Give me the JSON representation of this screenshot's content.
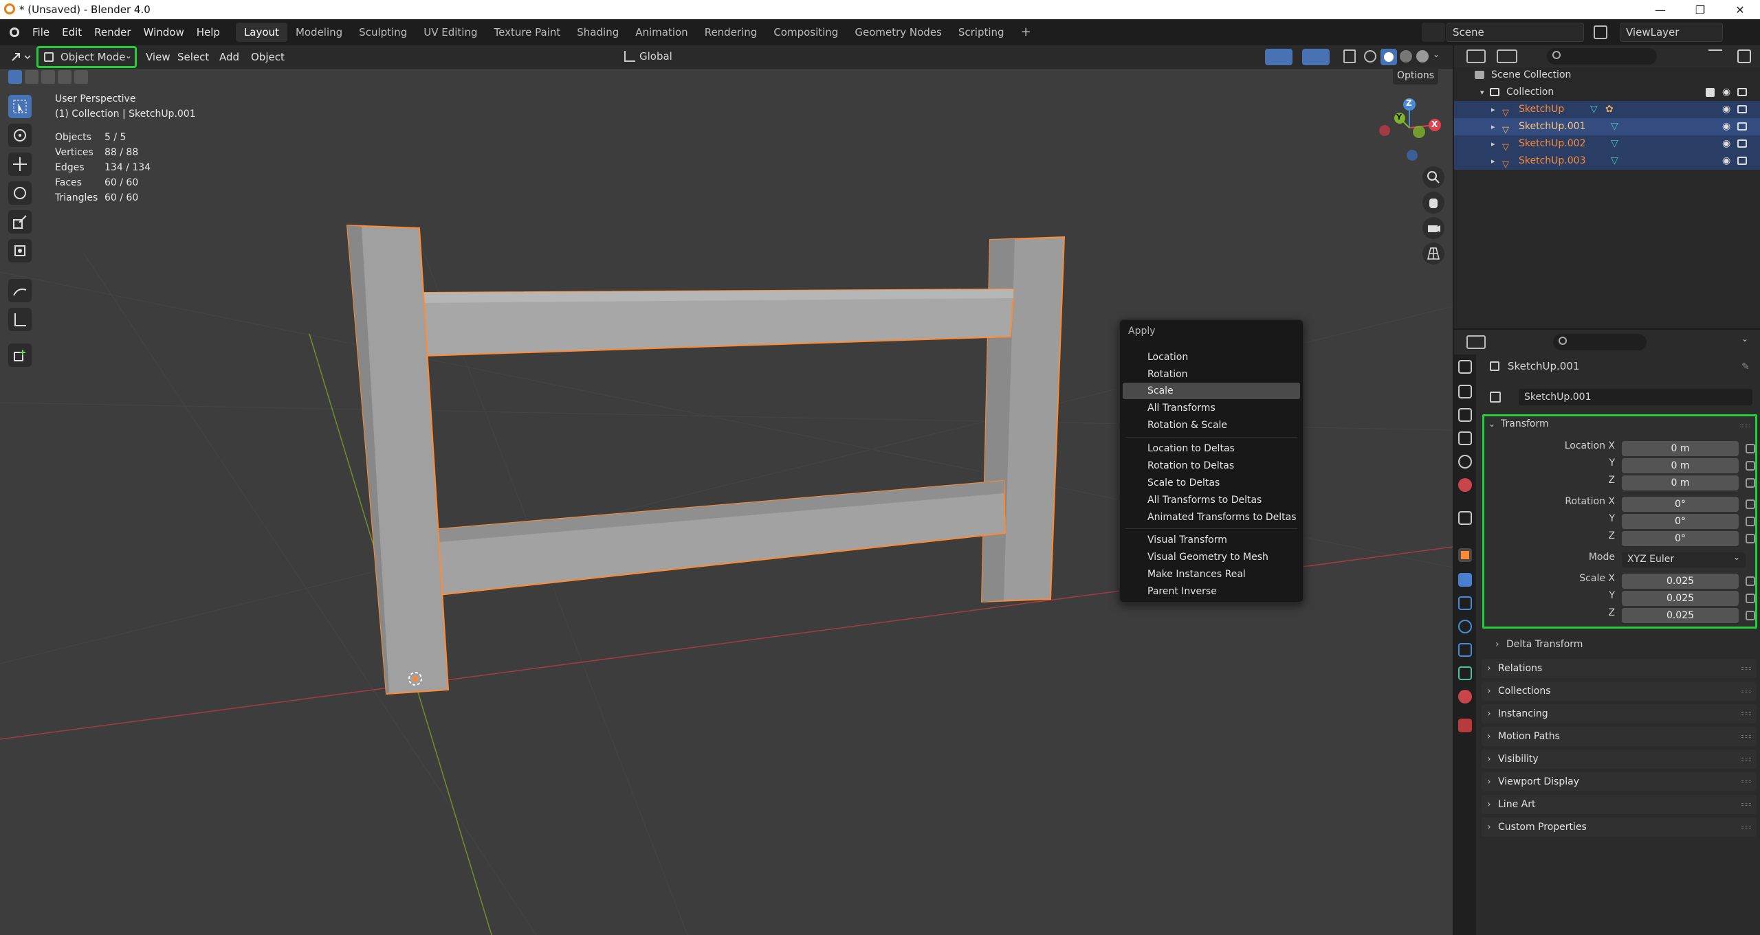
{
  "window": {
    "title": "* (Unsaved) - Blender 4.0",
    "min": "—",
    "max": "❐",
    "close": "✕"
  },
  "menu": [
    "File",
    "Edit",
    "Render",
    "Window",
    "Help"
  ],
  "workspaces": [
    "Layout",
    "Modeling",
    "Sculpting",
    "UV Editing",
    "Texture Paint",
    "Shading",
    "Animation",
    "Rendering",
    "Compositing",
    "Geometry Nodes",
    "Scripting"
  ],
  "add_workspace": "+",
  "scene": {
    "name": "Scene",
    "view_layer": "ViewLayer"
  },
  "viewport": {
    "mode": "Object Mode",
    "header_menus": [
      "View",
      "Select",
      "Add",
      "Object"
    ],
    "orientation": "Global",
    "options": "Options",
    "overlay_title": "User Perspective",
    "overlay_sub": "(1) Collection | SketchUp.001",
    "stats": [
      {
        "label": "Objects",
        "value": "5 / 5"
      },
      {
        "label": "Vertices",
        "value": "88 / 88"
      },
      {
        "label": "Edges",
        "value": "134 / 134"
      },
      {
        "label": "Faces",
        "value": "60 / 60"
      },
      {
        "label": "Triangles",
        "value": "60 / 60"
      }
    ],
    "gizmo": {
      "z": "Z",
      "y": "Y",
      "x": "X"
    }
  },
  "apply_menu": {
    "title": "Apply",
    "group1": [
      "Location",
      "Rotation",
      "Scale",
      "All Transforms",
      "Rotation & Scale"
    ],
    "group2": [
      "Location to Deltas",
      "Rotation to Deltas",
      "Scale to Deltas",
      "All Transforms to Deltas",
      "Animated Transforms to Deltas"
    ],
    "group3": [
      "Visual Transform",
      "Visual Geometry to Mesh",
      "Make Instances Real",
      "Parent Inverse"
    ],
    "highlighted": "Scale"
  },
  "outliner": {
    "scene_collection": "Scene Collection",
    "collection": "Collection",
    "objects": [
      "SketchUp",
      "SketchUp.001",
      "SketchUp.002",
      "SketchUp.003"
    ]
  },
  "properties": {
    "object_name": "SketchUp.001",
    "object_field": "SketchUp.001",
    "transform": {
      "title": "Transform",
      "loc_label": "Location X",
      "loc": [
        "0 m",
        "0 m",
        "0 m"
      ],
      "rot_label": "Rotation X",
      "rot": [
        "0°",
        "0°",
        "0°"
      ],
      "y": "Y",
      "z": "Z",
      "mode_label": "Mode",
      "mode": "XYZ Euler",
      "scale_label": "Scale X",
      "scale": [
        "0.025",
        "0.025",
        "0.025"
      ]
    },
    "delta_transform": "Delta Transform",
    "panels": [
      "Relations",
      "Collections",
      "Instancing",
      "Motion Paths",
      "Visibility",
      "Viewport Display",
      "Line Art",
      "Custom Properties"
    ]
  },
  "colors": {
    "accent": "#4772b3",
    "selection": "#ff8a33",
    "highlight_box": "#22d13a"
  }
}
